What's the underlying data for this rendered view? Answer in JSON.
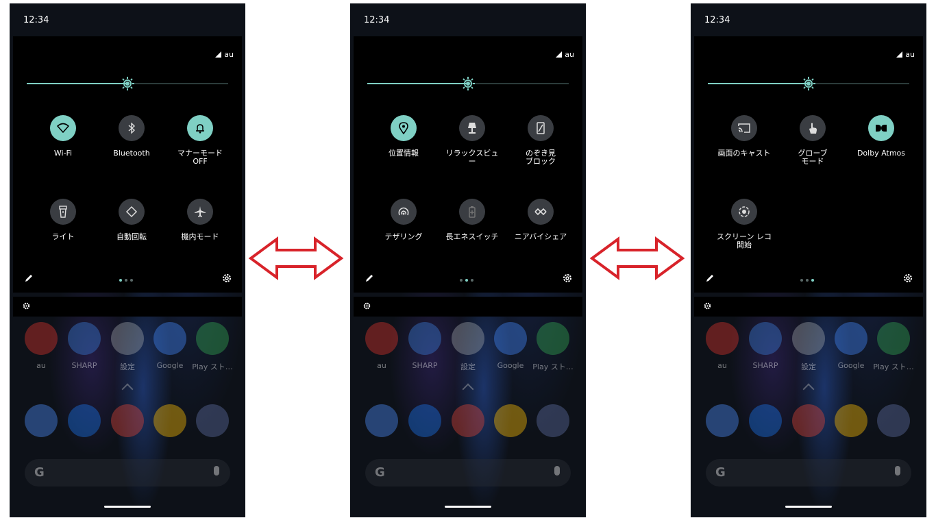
{
  "screens": [
    {
      "time": "12:34",
      "carrier": "au",
      "brightness": 0.5,
      "tiles": [
        {
          "label": "Wi-Fi",
          "icon": "wifi-icon",
          "state": "on"
        },
        {
          "label": "Bluetooth",
          "icon": "bluetooth-icon",
          "state": "off"
        },
        {
          "label": "マナーモード\nOFF",
          "icon": "bell-icon",
          "state": "on"
        },
        {
          "label": "ライト",
          "icon": "flashlight-icon",
          "state": "off"
        },
        {
          "label": "自動回転",
          "icon": "auto-rotate-icon",
          "state": "off"
        },
        {
          "label": "機内モード",
          "icon": "airplane-icon",
          "state": "off"
        }
      ],
      "active_page": 0
    },
    {
      "time": "12:34",
      "carrier": "au",
      "brightness": 0.5,
      "tiles": [
        {
          "label": "位置情報",
          "icon": "location-icon",
          "state": "on"
        },
        {
          "label": "リラックスビュ\nー",
          "icon": "lamp-icon",
          "state": "off"
        },
        {
          "label": "のぞき見\nブロック",
          "icon": "privacy-screen-icon",
          "state": "off"
        },
        {
          "label": "テザリング",
          "icon": "hotspot-icon",
          "state": "off"
        },
        {
          "label": "長エネスイッチ",
          "icon": "battery-saver-icon",
          "state": "off"
        },
        {
          "label": "ニアバイシェア",
          "icon": "nearby-share-icon",
          "state": "off"
        }
      ],
      "active_page": 1
    },
    {
      "time": "12:34",
      "carrier": "au",
      "brightness": 0.5,
      "tiles": [
        {
          "label": "画面のキャスト",
          "icon": "cast-icon",
          "state": "off"
        },
        {
          "label": "グローブ\nモード",
          "icon": "glove-touch-icon",
          "state": "off"
        },
        {
          "label": "Dolby Atmos",
          "icon": "dolby-icon",
          "state": "on"
        },
        {
          "label": "スクリーン レコ\n開始",
          "icon": "screen-record-icon",
          "state": "off"
        }
      ],
      "active_page": 2
    }
  ],
  "home": {
    "apps": [
      {
        "label": "au",
        "color": "#d8342c"
      },
      {
        "label": "SHARP",
        "color": "#3a7bd5"
      },
      {
        "label": "設定",
        "color": "#9aa0a6"
      },
      {
        "label": "Google",
        "color": "#4285f4"
      },
      {
        "label": "Play スト…",
        "color": "#34a853"
      }
    ],
    "dock": [
      {
        "name": "phone",
        "color": "#4c8bf5"
      },
      {
        "name": "messages",
        "color": "#1a73e8"
      },
      {
        "name": "chrome",
        "color": "#db4437"
      },
      {
        "name": "photos",
        "color": "#fbbc04"
      },
      {
        "name": "camera",
        "color": "#5f6fa3"
      }
    ],
    "search_logo": "G"
  },
  "colors": {
    "accent": "#7fd0c4",
    "tile_off": "#3a3d42",
    "arrow": "#d8232a"
  }
}
